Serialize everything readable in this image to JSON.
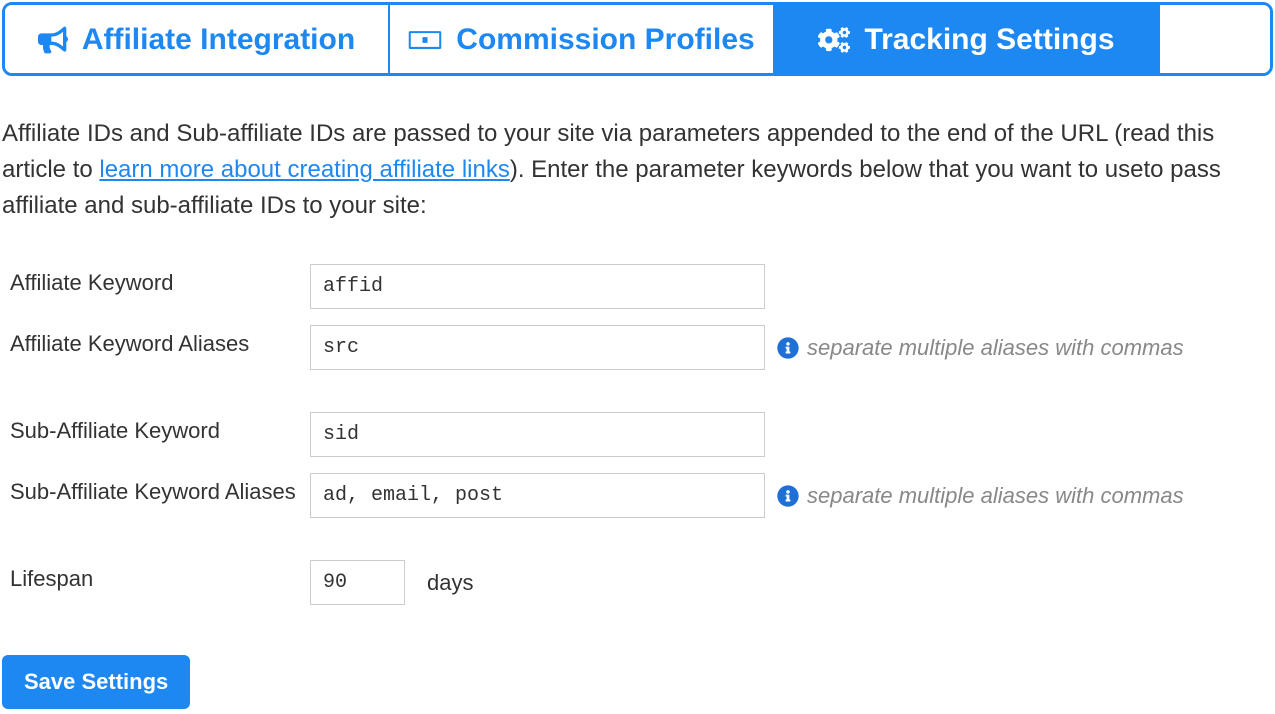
{
  "tabs": {
    "affiliate_integration": "Affiliate Integration",
    "commission_profiles": "Commission Profiles",
    "tracking_settings": "Tracking Settings"
  },
  "intro": {
    "part1": "Affiliate IDs and Sub-affiliate IDs are passed to your site via parameters appended to the end of the URL (read this article to ",
    "link": "learn more about creating affiliate links",
    "part2": "). Enter the parameter keywords below that you want to useto pass affiliate and sub-affiliate IDs to your site:"
  },
  "labels": {
    "affiliate_keyword": "Affiliate Keyword",
    "affiliate_keyword_aliases": "Affiliate Keyword Aliases",
    "sub_affiliate_keyword": "Sub-Affiliate Keyword",
    "sub_affiliate_keyword_aliases": "Sub-Affiliate Keyword Aliases",
    "lifespan": "Lifespan",
    "days": "days"
  },
  "values": {
    "affiliate_keyword": "affid",
    "affiliate_keyword_aliases": "src",
    "sub_affiliate_keyword": "sid",
    "sub_affiliate_keyword_aliases": "ad, email, post",
    "lifespan": "90"
  },
  "hints": {
    "aliases": "separate multiple aliases with commas"
  },
  "buttons": {
    "save": "Save Settings"
  }
}
